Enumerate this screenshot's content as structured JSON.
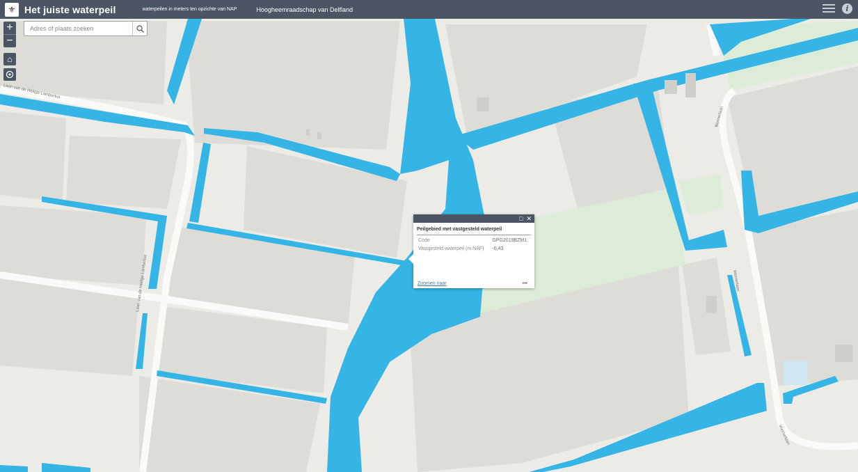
{
  "header": {
    "title": "Het juiste waterpeil",
    "subtitle": "waterpeilen in meters ten opzichte van NAP",
    "organization": "Hoogheemraadschap van Delfland",
    "logo_icon": "delfland-crest-icon",
    "menu_icon": "list-icon",
    "info_icon": "info-icon"
  },
  "controls": {
    "zoom_in": "+",
    "zoom_out": "−",
    "home_icon": "home-icon",
    "locate_icon": "locate-icon"
  },
  "search": {
    "placeholder": "Adres of plaats zoeken",
    "icon": "search-icon"
  },
  "popup": {
    "title": "Peilgebied met vastgesteld waterpeil",
    "fields": [
      {
        "label": "Code",
        "value": "GPG2019BZM1"
      },
      {
        "label": "Vastgesteld waterpeil (m NAF)",
        "value": "-0,43"
      }
    ],
    "zoom_link": "Zoomen naar",
    "more": "•••"
  },
  "map": {
    "streets": [
      "Laan van de Heilige Lambertus",
      "Laan van de Heilige Lambertus",
      "Wernerlaan",
      "Wernerlaan",
      "Wernerlaan"
    ],
    "water_color": "#35b5e5",
    "land_color": "#ecebe6",
    "building_color": "#dddcd7",
    "grass_color": "#dcecd7"
  }
}
